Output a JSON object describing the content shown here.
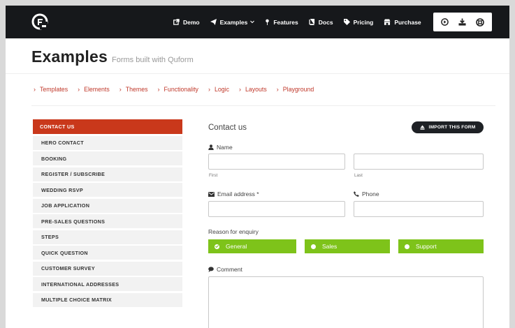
{
  "header": {
    "nav": [
      {
        "label": "Demo",
        "icon": "external-link-icon"
      },
      {
        "label": "Examples",
        "icon": "paper-plane-icon"
      },
      {
        "label": "Features",
        "icon": "map-pin-icon"
      },
      {
        "label": "Docs",
        "icon": "book-icon"
      },
      {
        "label": "Pricing",
        "icon": "tag-icon"
      },
      {
        "label": "Purchase",
        "icon": "shop-icon"
      }
    ],
    "icons": [
      "play-icon",
      "download-icon",
      "support-icon"
    ]
  },
  "page": {
    "title": "Examples",
    "subtitle": "Forms built with Quform"
  },
  "subnav": [
    "Templates",
    "Elements",
    "Themes",
    "Functionality",
    "Logic",
    "Layouts",
    "Playground"
  ],
  "sidebar": {
    "items": [
      "CONTACT US",
      "HERO CONTACT",
      "BOOKING",
      "REGISTER / SUBSCRIBE",
      "WEDDING RSVP",
      "JOB APPLICATION",
      "PRE-SALES QUESTIONS",
      "STEPS",
      "QUICK QUESTION",
      "CUSTOMER SURVEY",
      "INTERNATIONAL ADDRESSES",
      "MULTIPLE CHOICE MATRIX"
    ]
  },
  "form": {
    "title": "Contact us",
    "import_label": "IMPORT THIS FORM",
    "name_label": "Name",
    "first_label": "First",
    "last_label": "Last",
    "email_label": "Email address *",
    "phone_label": "Phone",
    "reason_label": "Reason for enquiry",
    "reasons": [
      "General",
      "Sales",
      "Support"
    ],
    "comment_label": "Comment"
  },
  "colors": {
    "accent": "#c9381b",
    "link": "#c0392b",
    "radio": "#7ec31a",
    "header": "#16181b"
  }
}
